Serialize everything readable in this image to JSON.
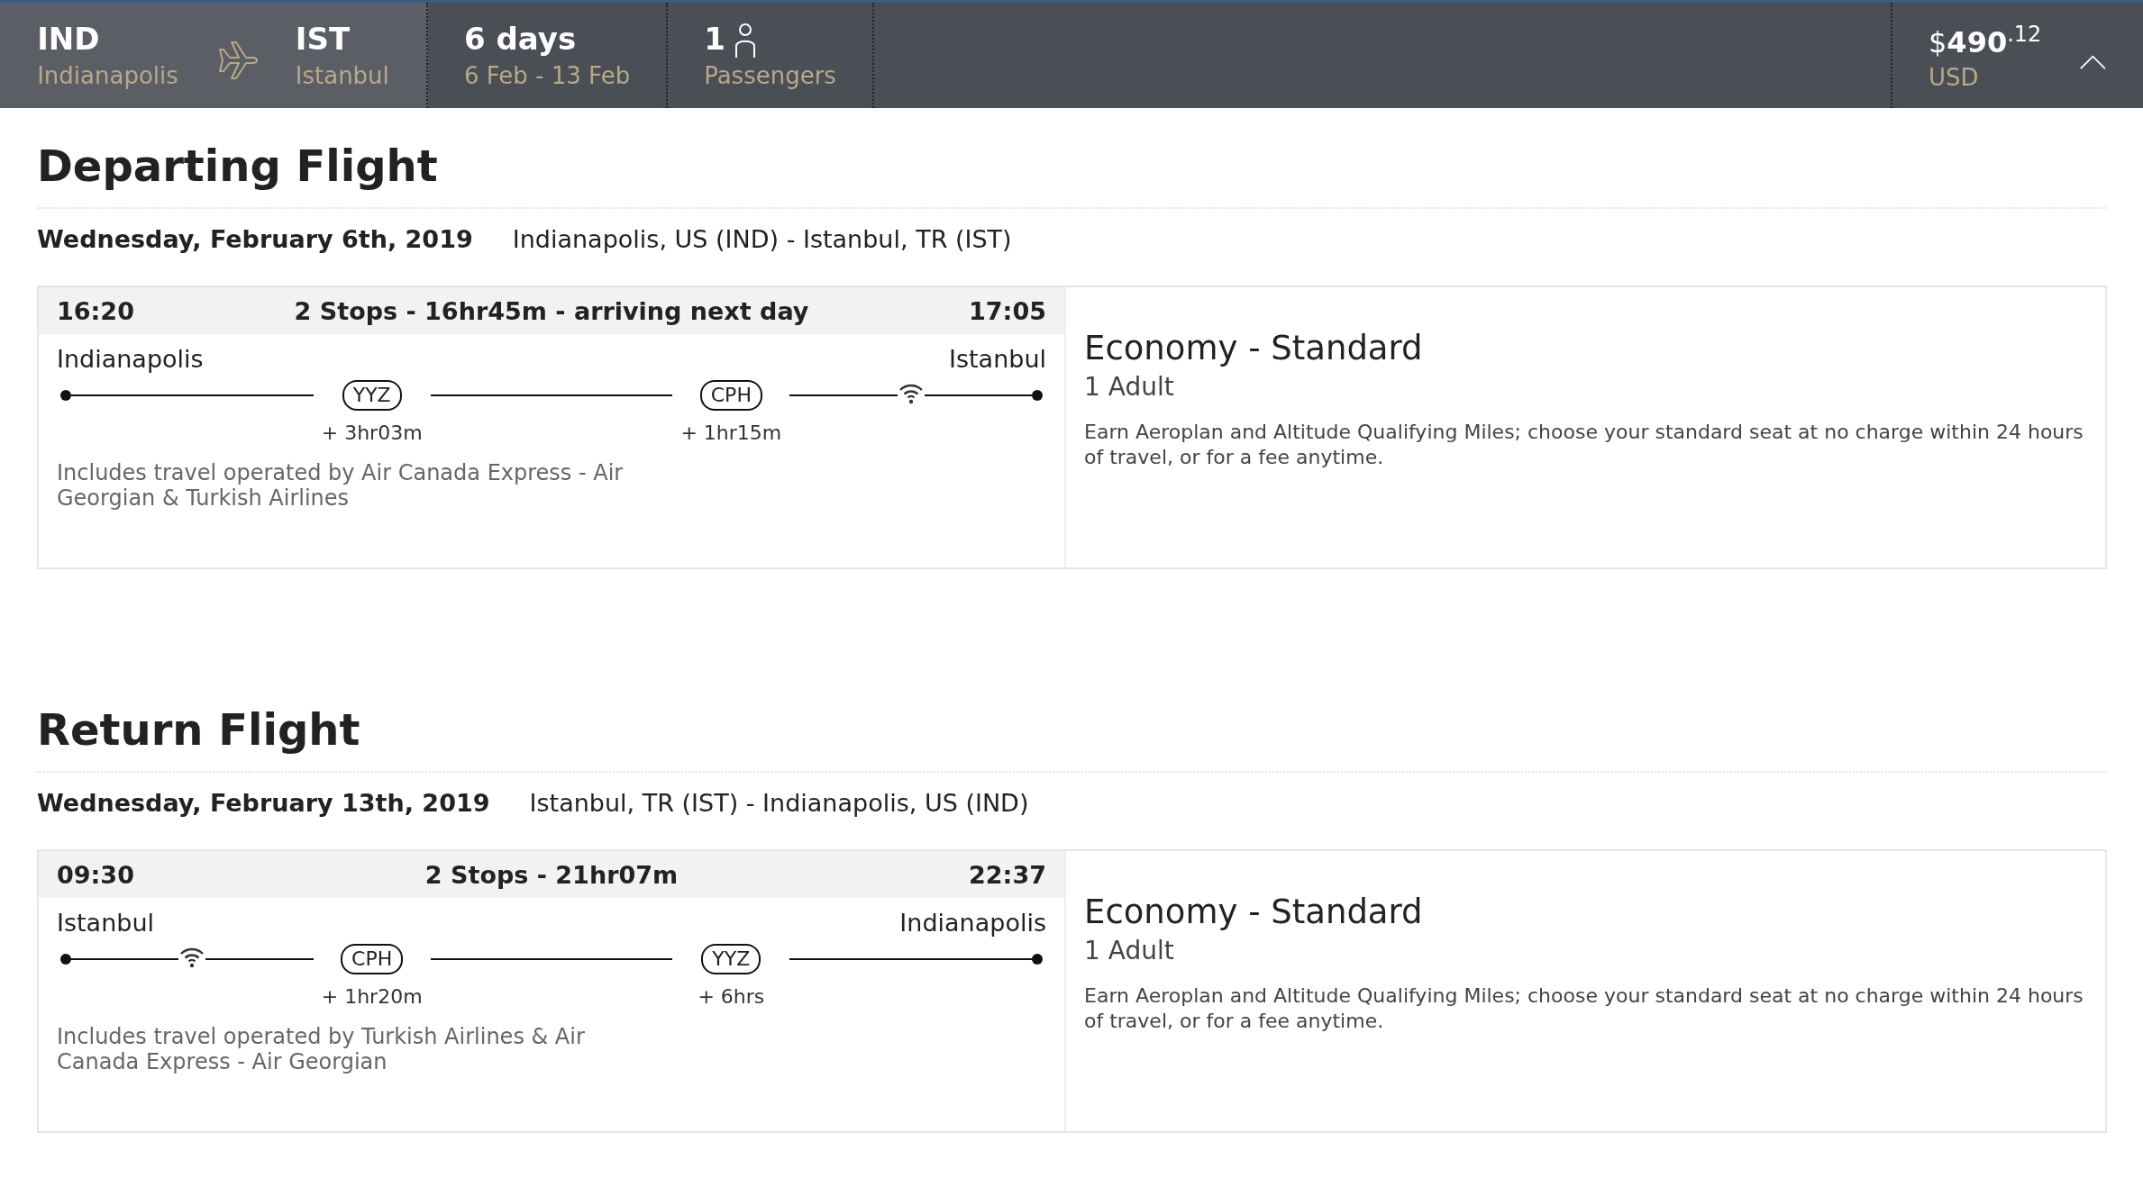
{
  "summary_bar": {
    "origin": {
      "code": "IND",
      "city": "Indianapolis"
    },
    "destination": {
      "code": "IST",
      "city": "Istanbul"
    },
    "duration": {
      "title": "6 days",
      "dates": "6 Feb - 13 Feb"
    },
    "passengers": {
      "count": "1",
      "label": "Passengers"
    },
    "price": {
      "amount": "$**490**$^{.12}$",
      "currency": "USD"
    },
    "expanded": true
  },
  "flights": [
    {
      "heading": "Departing Flight",
      "date": "Wednesday, February 6th, 2019",
      "route": "Indianapolis, US (IND) - Istanbul, TR (IST)",
      "depart_time": "16:20",
      "summary": "2 Stops - 16hr45m - arriving next day",
      "arrive_time": "17:05",
      "from_city": "Indianapolis",
      "to_city": "Istanbul",
      "timeline": [
        {
          "kind": "stop",
          "code": "YYZ",
          "layover": "+ 3hr03m"
        },
        {
          "kind": "stop",
          "code": "CPH",
          "layover": "+ 1hr15m"
        },
        {
          "kind": "wifi"
        }
      ],
      "operators": "Includes travel operated by Air Canada Express - Air Georgian & Turkish Airlines",
      "fare": "Economy - Standard",
      "travellers": "1 Adult",
      "fare_note": "Earn Aeroplan and Altitude Qualifying Miles; choose your standard seat at no charge within 24 hours of travel, or for a fee anytime."
    },
    {
      "heading": "Return Flight",
      "date": "Wednesday, February 13th, 2019",
      "route": "Istanbul, TR (IST) - Indianapolis, US (IND)",
      "depart_time": "09:30",
      "summary": "2 Stops - 21hr07m",
      "arrive_time": "22:37",
      "from_city": "Istanbul",
      "to_city": "Indianapolis",
      "timeline": [
        {
          "kind": "wifi"
        },
        {
          "kind": "stop",
          "code": "CPH",
          "layover": "+ 1hr20m"
        },
        {
          "kind": "stop",
          "code": "YYZ",
          "layover": "+ 6hrs"
        }
      ],
      "operators": "Includes travel operated by Turkish Airlines & Air Canada Express - Air Georgian",
      "fare": "Economy - Standard",
      "travellers": "1 Adult",
      "fare_note": "Earn Aeroplan and Altitude Qualifying Miles; choose your standard seat at no charge within 24 hours of travel, or for a fee anytime."
    }
  ]
}
